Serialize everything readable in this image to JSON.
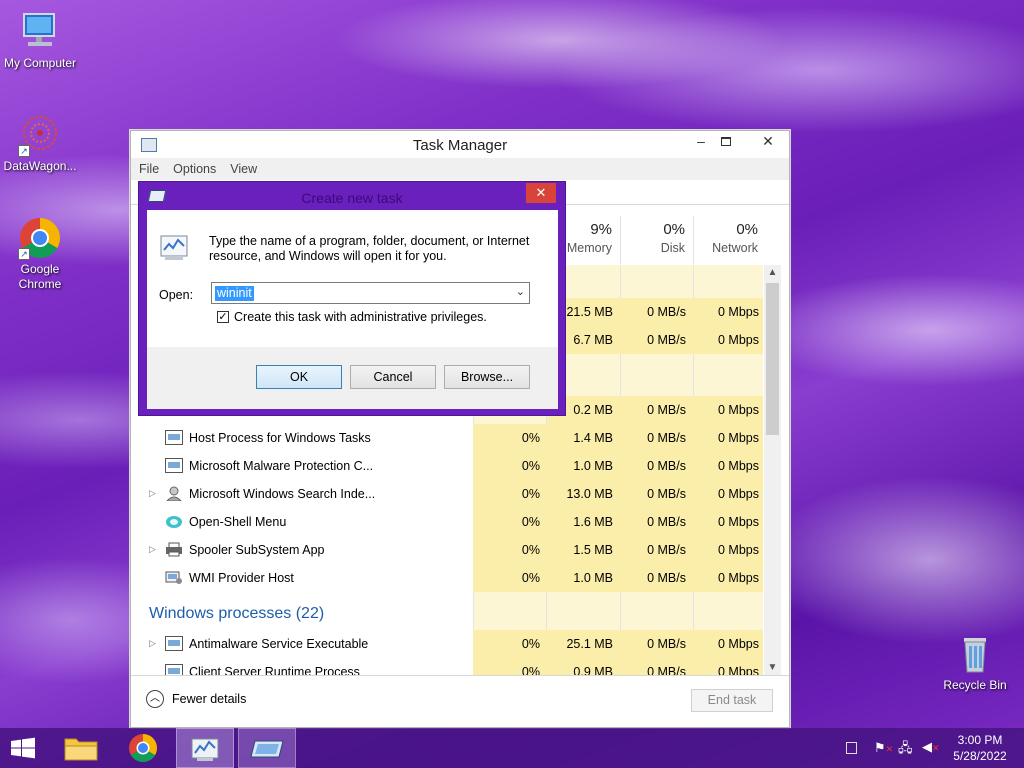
{
  "desktop": {
    "icons": [
      {
        "label": "My Computer"
      },
      {
        "label": "DataWagon..."
      },
      {
        "label": "Google Chrome"
      },
      {
        "label": "Recycle Bin"
      }
    ]
  },
  "task_manager": {
    "title": "Task Manager",
    "menu": [
      "File",
      "Options",
      "View"
    ],
    "columns": [
      {
        "pct": "9%",
        "label": "Memory"
      },
      {
        "pct": "0%",
        "label": "Disk"
      },
      {
        "pct": "0%",
        "label": "Network"
      }
    ],
    "rows_top": [
      {
        "memory": "21.5 MB",
        "disk": "0 MB/s",
        "network": "0 Mbps"
      },
      {
        "memory": "6.7 MB",
        "disk": "0 MB/s",
        "network": "0 Mbps"
      },
      {
        "memory": "0.2 MB",
        "disk": "0 MB/s",
        "network": "0 Mbps"
      }
    ],
    "processes": [
      {
        "name": "Host Process for Windows Tasks",
        "cpu": "0%",
        "memory": "1.4 MB",
        "disk": "0 MB/s",
        "network": "0 Mbps",
        "icon": "service-window-icon"
      },
      {
        "name": "Microsoft Malware Protection C...",
        "cpu": "0%",
        "memory": "1.0 MB",
        "disk": "0 MB/s",
        "network": "0 Mbps",
        "icon": "service-window-icon"
      },
      {
        "name": "Microsoft Windows Search Inde...",
        "cpu": "0%",
        "memory": "13.0 MB",
        "disk": "0 MB/s",
        "network": "0 Mbps",
        "icon": "search-user-icon"
      },
      {
        "name": "Open-Shell Menu",
        "cpu": "0%",
        "memory": "1.6 MB",
        "disk": "0 MB/s",
        "network": "0 Mbps",
        "icon": "shell-icon"
      },
      {
        "name": "Spooler SubSystem App",
        "cpu": "0%",
        "memory": "1.5 MB",
        "disk": "0 MB/s",
        "network": "0 Mbps",
        "icon": "printer-icon"
      },
      {
        "name": "WMI Provider Host",
        "cpu": "0%",
        "memory": "1.0 MB",
        "disk": "0 MB/s",
        "network": "0 Mbps",
        "icon": "wmi-icon"
      }
    ],
    "windows_group_title": "Windows processes (22)",
    "windows_processes": [
      {
        "name": "Antimalware Service Executable",
        "cpu": "0%",
        "memory": "25.1 MB",
        "disk": "0 MB/s",
        "network": "0 Mbps"
      },
      {
        "name": "Client Server Runtime Process",
        "cpu": "0%",
        "memory": "0.9 MB",
        "disk": "0 MB/s",
        "network": "0 Mbps"
      }
    ],
    "fewer_details": "Fewer details",
    "end_task": "End task"
  },
  "dialog": {
    "title": "Create new task",
    "description": "Type the name of a program, folder, document, or Internet resource, and Windows will open it for you.",
    "open_label": "Open:",
    "open_value": "wininit",
    "admin_checkbox_label": "Create this task with administrative privileges.",
    "admin_checked": true,
    "ok": "OK",
    "cancel": "Cancel",
    "browse": "Browse..."
  },
  "taskbar": {
    "time": "3:00 PM",
    "date": "5/28/2022"
  },
  "colors": {
    "accent_dialog": "#6a20bd",
    "heat_cell": "#fff4c4",
    "group_title": "#1c5ea8"
  }
}
